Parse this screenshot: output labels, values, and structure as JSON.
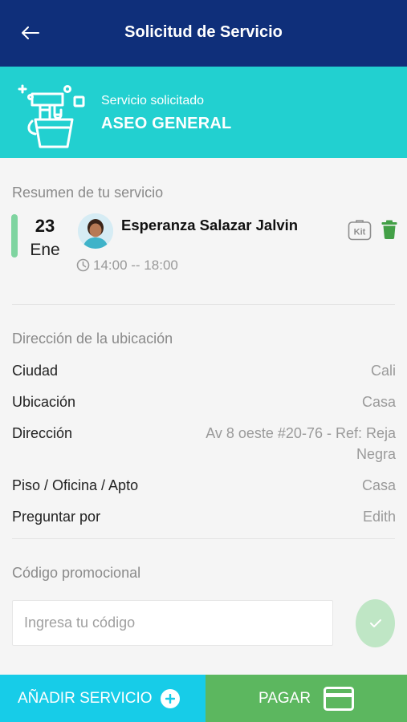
{
  "header": {
    "title": "Solicitud de Servicio",
    "back_icon": "arrow-left-icon"
  },
  "service": {
    "caption": "Servicio solicitado",
    "name": "ASEO GENERAL",
    "icon": "cleaning-bucket-icon"
  },
  "summary": {
    "title": "Resumen de tu servicio",
    "date_day": "23",
    "date_month": "Ene",
    "worker_name": "Esperanza Salazar Jalvin",
    "time_range": "14:00 -- 18:00",
    "kit_label": "Kit"
  },
  "address": {
    "title": "Dirección de la ubicación",
    "rows": [
      {
        "label": "Ciudad",
        "value": "Cali"
      },
      {
        "label": "Ubicación",
        "value": "Casa"
      },
      {
        "label": "Dirección",
        "value": "Av 8 oeste #20-76 - Ref: Reja Negra"
      },
      {
        "label": "Piso / Oficina / Apto",
        "value": "Casa"
      },
      {
        "label": "Preguntar por",
        "value": "Edith"
      }
    ]
  },
  "promo": {
    "title": "Código promocional",
    "placeholder": "Ingresa tu código",
    "value": ""
  },
  "footer": {
    "add_label": "AÑADIR SERVICIO",
    "pay_label": "PAGAR"
  },
  "colors": {
    "appbar": "#0f2f7a",
    "banner": "#22d0d0",
    "add_button": "#17cce8",
    "pay_button": "#5cb75f",
    "accent_green": "#7fd4a0"
  }
}
